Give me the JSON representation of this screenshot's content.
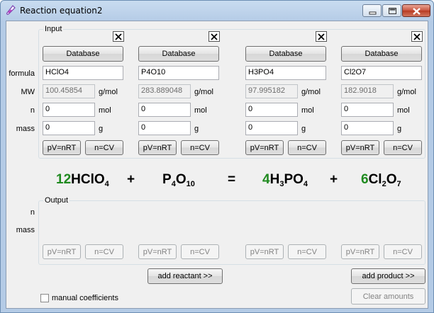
{
  "window": {
    "title": "Reaction equation2",
    "controls": {
      "minimize": "minimize-icon",
      "maximize": "maximize-icon",
      "close": "close-icon"
    }
  },
  "input_group": {
    "label": "Input"
  },
  "output_group": {
    "label": "Output"
  },
  "row_labels": {
    "formula": "formula",
    "mw": "MW",
    "n": "n",
    "mass": "mass"
  },
  "output_row_labels": {
    "n": "n",
    "mass": "mass"
  },
  "compounds": [
    {
      "database_label": "Database",
      "formula": "HClO4",
      "mw": "100.45854",
      "mw_unit": "g/mol",
      "n": "0",
      "n_unit": "mol",
      "mass": "0",
      "mass_unit": "g",
      "pv_label": "pV=nRT",
      "ncv_label": "n=CV"
    },
    {
      "database_label": "Database",
      "formula": "P4O10",
      "mw": "283.889048",
      "mw_unit": "g/mol",
      "n": "0",
      "n_unit": "mol",
      "mass": "0",
      "mass_unit": "g",
      "pv_label": "pV=nRT",
      "ncv_label": "n=CV"
    },
    {
      "database_label": "Database",
      "formula": "H3PO4",
      "mw": "97.995182",
      "mw_unit": "g/mol",
      "n": "0",
      "n_unit": "mol",
      "mass": "0",
      "mass_unit": "g",
      "pv_label": "pV=nRT",
      "ncv_label": "n=CV"
    },
    {
      "database_label": "Database",
      "formula": "Cl2O7",
      "mw": "182.9018",
      "mw_unit": "g/mol",
      "n": "0",
      "n_unit": "mol",
      "mass": "0",
      "mass_unit": "g",
      "pv_label": "pV=nRT",
      "ncv_label": "n=CV"
    }
  ],
  "equation": {
    "terms": [
      {
        "coef": "12",
        "parts": [
          {
            "t": "HClO"
          },
          {
            "s": "4"
          }
        ]
      },
      {
        "coef": "",
        "parts": [
          {
            "t": "P"
          },
          {
            "s": "4"
          },
          {
            "t": "O"
          },
          {
            "s": "10"
          }
        ]
      },
      {
        "coef": "4",
        "parts": [
          {
            "t": "H"
          },
          {
            "s": "3"
          },
          {
            "t": "PO"
          },
          {
            "s": "4"
          }
        ]
      },
      {
        "coef": "6",
        "parts": [
          {
            "t": "Cl"
          },
          {
            "s": "2"
          },
          {
            "t": "O"
          },
          {
            "s": "7"
          }
        ]
      }
    ],
    "op1": "+",
    "op2": "=",
    "op3": "+",
    "coef_color": "#1f8a1f"
  },
  "output_buttons": [
    {
      "pv_label": "pV=nRT",
      "ncv_label": "n=CV"
    },
    {
      "pv_label": "pV=nRT",
      "ncv_label": "n=CV"
    },
    {
      "pv_label": "pV=nRT",
      "ncv_label": "n=CV"
    },
    {
      "pv_label": "pV=nRT",
      "ncv_label": "n=CV"
    }
  ],
  "actions": {
    "add_reactant": "add reactant >>",
    "add_product": "add product >>",
    "clear_amounts": "Clear amounts",
    "manual_coefficients": "manual coefficients"
  }
}
